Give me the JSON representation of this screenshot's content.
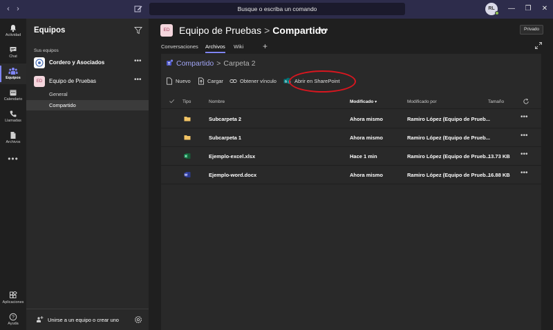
{
  "titlebar": {
    "back": "‹",
    "forward": "›",
    "search_placeholder": "Busque o escriba un comando",
    "user_initials": "RL",
    "minimize": "—",
    "maximize": "❐",
    "close": "✕"
  },
  "rail": {
    "items": [
      {
        "label": "Actividad",
        "icon": "bell-icon"
      },
      {
        "label": "Chat",
        "icon": "chat-icon"
      },
      {
        "label": "Equipos",
        "icon": "teams-icon"
      },
      {
        "label": "Calendario",
        "icon": "calendar-icon"
      },
      {
        "label": "Llamadas",
        "icon": "phone-icon"
      },
      {
        "label": "Archivos",
        "icon": "files-icon"
      }
    ],
    "more": "•••",
    "apps": "Aplicaciones",
    "help": "Ayuda"
  },
  "teams_panel": {
    "title": "Equipos",
    "section": "Sus equipos",
    "teams": [
      {
        "name": "Cordero y Asociados",
        "avatar": "",
        "bold": true
      },
      {
        "name": "Equipo de Pruebas",
        "avatar": "ED",
        "bold": false
      }
    ],
    "channels": [
      "General",
      "Compartido"
    ],
    "active_channel": "Compartido",
    "more": "•••",
    "join_label": "Unirse a un equipo o crear uno"
  },
  "channel_header": {
    "avatar": "ED",
    "team": "Equipo de Pruebas",
    "separator": ">",
    "channel": "Compartido",
    "more": "•••",
    "privacy": "Privado",
    "tabs": [
      "Conversaciones",
      "Archivos",
      "Wiki"
    ],
    "active_tab": "Archivos",
    "add_tab": "+"
  },
  "files": {
    "breadcrumb": {
      "root": "Compartido",
      "separator": ">",
      "current": "Carpeta 2"
    },
    "toolbar": {
      "new": "Nuevo",
      "upload": "Cargar",
      "get_link": "Obtener vínculo",
      "open_sharepoint": "Abrir en SharePoint"
    },
    "columns": {
      "type": "Tipo",
      "name": "Nombre",
      "modified": "Modificado",
      "sort_indicator": "▾",
      "modified_by": "Modificado por",
      "size": "Tamaño"
    },
    "rows": [
      {
        "type_icon": "folder-icon",
        "name": "Subcarpeta 2",
        "modified": "Ahora mismo",
        "modified_by": "Ramiro López (Equipo de Prueb...",
        "size": "",
        "more": "•••"
      },
      {
        "type_icon": "folder-icon",
        "name": "Subcarpeta 1",
        "modified": "Ahora mismo",
        "modified_by": "Ramiro López (Equipo de Prueb...",
        "size": "",
        "more": "•••"
      },
      {
        "type_icon": "excel-icon",
        "name": "Ejemplo-excel.xlsx",
        "modified": "Hace 1 min",
        "modified_by": "Ramiro López (Equipo de Prueb...",
        "size": "13.73 KB",
        "more": "•••"
      },
      {
        "type_icon": "word-icon",
        "name": "Ejemplo-word.docx",
        "modified": "Ahora mismo",
        "modified_by": "Ramiro López (Equipo de Prueb...",
        "size": "16.88 KB",
        "more": "•••"
      }
    ]
  },
  "colors": {
    "accent": "#7f85f5",
    "titlebar": "#2d2c4b",
    "highlight": "#d9161f",
    "folder": "#f2c465",
    "excel": "#21a366",
    "word": "#4a57c4"
  }
}
